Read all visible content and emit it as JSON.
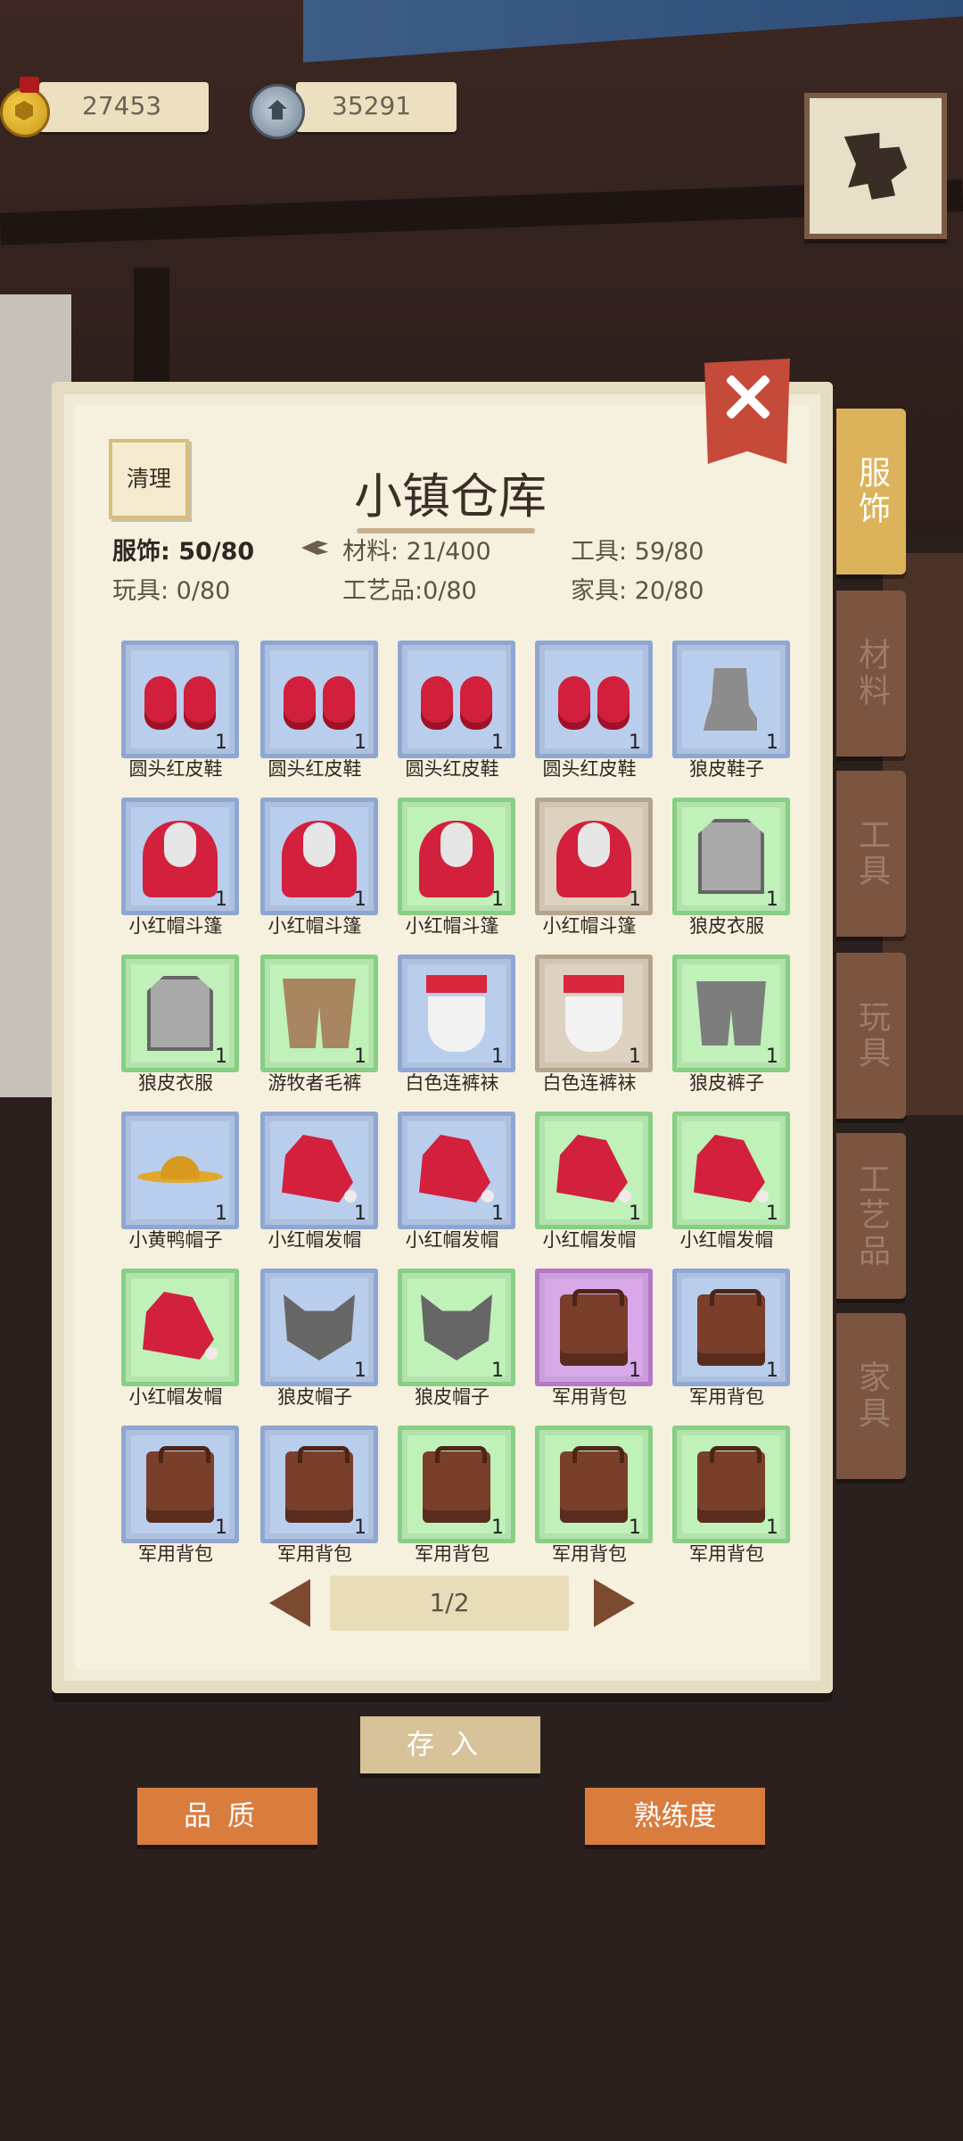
{
  "currency": {
    "gold": "27453",
    "gems": "35291"
  },
  "panel": {
    "title": "小镇仓库",
    "clean_label": "清理",
    "stats": [
      {
        "label": "服饰: 50/80",
        "active": true
      },
      {
        "label": "材料: 21/400",
        "active": false
      },
      {
        "label": "工具: 59/80",
        "active": false
      },
      {
        "label": "玩具: 0/80",
        "active": false
      },
      {
        "label": "工艺品:0/80",
        "active": false
      },
      {
        "label": "家具: 20/80",
        "active": false
      }
    ],
    "page": "1/2"
  },
  "items": [
    {
      "name": "圆头红皮鞋",
      "qty": "1",
      "rarity": "blue",
      "icon": "red-shoes-icon",
      "art": "shoes"
    },
    {
      "name": "圆头红皮鞋",
      "qty": "1",
      "rarity": "blue",
      "icon": "red-shoes-icon",
      "art": "shoes"
    },
    {
      "name": "圆头红皮鞋",
      "qty": "1",
      "rarity": "blue",
      "icon": "red-shoes-icon",
      "art": "shoes"
    },
    {
      "name": "圆头红皮鞋",
      "qty": "1",
      "rarity": "blue",
      "icon": "red-shoes-icon",
      "art": "shoes"
    },
    {
      "name": "狼皮鞋子",
      "qty": "1",
      "rarity": "blue",
      "icon": "wolf-boots-icon",
      "art": "boots"
    },
    {
      "name": "小红帽斗篷",
      "qty": "1",
      "rarity": "blue",
      "icon": "red-cape-icon",
      "art": "cape"
    },
    {
      "name": "小红帽斗篷",
      "qty": "1",
      "rarity": "blue",
      "icon": "red-cape-icon",
      "art": "cape"
    },
    {
      "name": "小红帽斗篷",
      "qty": "1",
      "rarity": "green",
      "icon": "red-cape-icon",
      "art": "cape"
    },
    {
      "name": "小红帽斗篷",
      "qty": "1",
      "rarity": "tan",
      "icon": "red-cape-icon",
      "art": "cape"
    },
    {
      "name": "狼皮衣服",
      "qty": "1",
      "rarity": "green",
      "icon": "wolf-vest-icon",
      "art": "vest"
    },
    {
      "name": "狼皮衣服",
      "qty": "1",
      "rarity": "green",
      "icon": "wolf-vest-icon",
      "art": "vest"
    },
    {
      "name": "游牧者毛裤",
      "qty": "1",
      "rarity": "green",
      "icon": "nomad-pants-icon",
      "art": "pants"
    },
    {
      "name": "白色连裤袜",
      "qty": "1",
      "rarity": "blue",
      "icon": "white-tights-icon",
      "art": "longjohns"
    },
    {
      "name": "白色连裤袜",
      "qty": "1",
      "rarity": "tan",
      "icon": "white-tights-icon",
      "art": "longjohns"
    },
    {
      "name": "狼皮裤子",
      "qty": "1",
      "rarity": "green",
      "icon": "wolf-pants-icon",
      "art": "wolfpants"
    },
    {
      "name": "小黄鸭帽子",
      "qty": "1",
      "rarity": "blue",
      "icon": "duck-hat-icon",
      "art": "duckhat"
    },
    {
      "name": "小红帽发帽",
      "qty": "1",
      "rarity": "blue",
      "icon": "red-hood-icon",
      "art": "redhat"
    },
    {
      "name": "小红帽发帽",
      "qty": "1",
      "rarity": "blue",
      "icon": "red-hood-icon",
      "art": "redhat"
    },
    {
      "name": "小红帽发帽",
      "qty": "1",
      "rarity": "green",
      "icon": "red-hood-icon",
      "art": "redhat"
    },
    {
      "name": "小红帽发帽",
      "qty": "1",
      "rarity": "green",
      "icon": "red-hood-icon",
      "art": "redhat"
    },
    {
      "name": "小红帽发帽",
      "qty": "",
      "rarity": "green",
      "icon": "red-hood-icon",
      "art": "redhat"
    },
    {
      "name": "狼皮帽子",
      "qty": "1",
      "rarity": "blue",
      "icon": "wolf-hat-icon",
      "art": "wolfhat"
    },
    {
      "name": "狼皮帽子",
      "qty": "1",
      "rarity": "green",
      "icon": "wolf-hat-icon",
      "art": "wolfhat"
    },
    {
      "name": "军用背包",
      "qty": "1",
      "rarity": "purple",
      "icon": "backpack-icon",
      "art": "backpack"
    },
    {
      "name": "军用背包",
      "qty": "1",
      "rarity": "blue",
      "icon": "backpack-icon",
      "art": "backpack"
    },
    {
      "name": "军用背包",
      "qty": "1",
      "rarity": "blue",
      "icon": "backpack-icon",
      "art": "backpack"
    },
    {
      "name": "军用背包",
      "qty": "1",
      "rarity": "blue",
      "icon": "backpack-icon",
      "art": "backpack"
    },
    {
      "name": "军用背包",
      "qty": "1",
      "rarity": "green",
      "icon": "backpack-icon",
      "art": "backpack"
    },
    {
      "name": "军用背包",
      "qty": "1",
      "rarity": "green",
      "icon": "backpack-icon",
      "art": "backpack"
    },
    {
      "name": "军用背包",
      "qty": "1",
      "rarity": "green",
      "icon": "backpack-icon",
      "art": "backpack"
    }
  ],
  "tabs": [
    {
      "label": "服饰",
      "active": true
    },
    {
      "label": "材料",
      "active": false
    },
    {
      "label": "工具",
      "active": false
    },
    {
      "label": "玩具",
      "active": false
    },
    {
      "label": "工艺品",
      "active": false
    },
    {
      "label": "家具",
      "active": false
    }
  ],
  "buttons": {
    "deposit": "存入",
    "quality": "品质",
    "mastery": "熟练度"
  },
  "colors": {
    "rare_blue": "#b9cdec",
    "uncommon_green": "#bff1b8",
    "common_tan": "#ddd2c0",
    "epic_purple": "#d8a8e8",
    "button_orange": "#da7c3e",
    "tab_active": "#dcb35a"
  }
}
